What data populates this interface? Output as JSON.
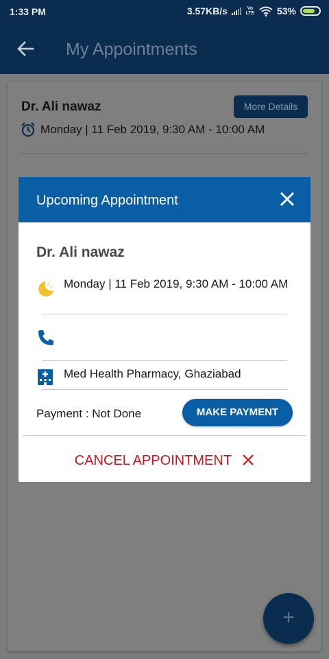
{
  "status_bar": {
    "time": "1:33 PM",
    "network_speed": "3.57KB/s",
    "volte_label": "Vo LTE",
    "battery": "53%",
    "icons": [
      "signal-icon",
      "volte-icon",
      "wifi-icon",
      "battery-charging-icon"
    ]
  },
  "app_bar": {
    "title": "My Appointments",
    "back_icon": "arrow-back-icon"
  },
  "appointment_card": {
    "doctor": "Dr. Ali nawaz",
    "more_button": "More Details",
    "datetime": "Monday | 11 Feb 2019, 9:30 AM - 10:00 AM",
    "icon": "alarm-clock-icon"
  },
  "dialog": {
    "title": "Upcoming Appointment",
    "close_icon": "close-icon",
    "doctor": "Dr. Ali nawaz",
    "datetime": "Monday | 11 Feb 2019, 9:30 AM - 10:00 AM",
    "phone": "",
    "location": "Med Health Pharmacy, Ghaziabad",
    "payment_status": "Payment : Not Done",
    "make_payment_button": "MAKE PAYMENT",
    "cancel_button": "CANCEL APPOINTMENT",
    "icons": [
      "moon-icon",
      "phone-icon",
      "hospital-icon"
    ]
  },
  "fab": {
    "label": "+",
    "icon": "add-icon"
  },
  "colors": {
    "app_bar": "#0a2d4f",
    "dialog_header": "#0a5ea6",
    "cancel": "#c4161c",
    "scrim_background": "#7c7c7c"
  }
}
